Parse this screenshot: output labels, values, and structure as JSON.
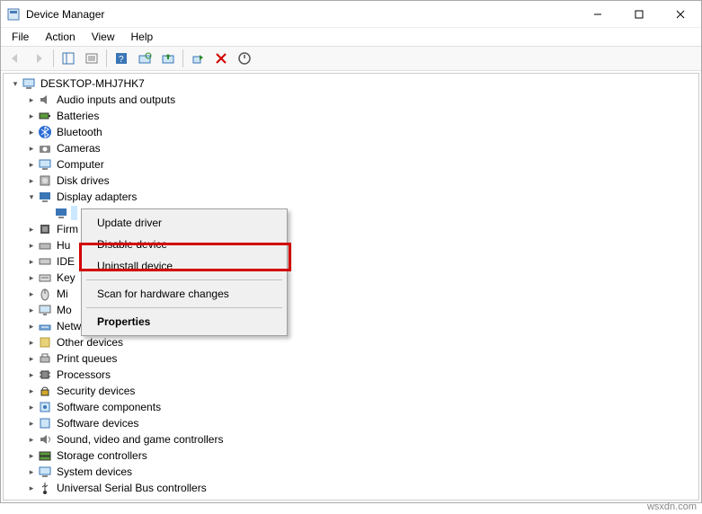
{
  "window": {
    "title": "Device Manager"
  },
  "menu": {
    "file": "File",
    "action": "Action",
    "view": "View",
    "help": "Help"
  },
  "root": "DESKTOP-MHJ7HK7",
  "categories": {
    "audio": "Audio inputs and outputs",
    "batteries": "Batteries",
    "bluetooth": "Bluetooth",
    "cameras": "Cameras",
    "computer": "Computer",
    "disk": "Disk drives",
    "display": "Display adapters",
    "firmware": "Firm",
    "hid": "Hu",
    "ide": "IDE",
    "keyboards": "Key",
    "mice": "Mi",
    "monitors": "Mo",
    "network": "Network adapters",
    "other": "Other devices",
    "printq": "Print queues",
    "processors": "Processors",
    "security": "Security devices",
    "swcomp": "Software components",
    "swdev": "Software devices",
    "sound": "Sound, video and game controllers",
    "storage": "Storage controllers",
    "system": "System devices",
    "usb": "Universal Serial Bus controllers"
  },
  "context_menu": {
    "update": "Update driver",
    "disable": "Disable device",
    "uninstall": "Uninstall device",
    "scan": "Scan for hardware changes",
    "properties": "Properties"
  },
  "watermark": "wsxdn.com"
}
